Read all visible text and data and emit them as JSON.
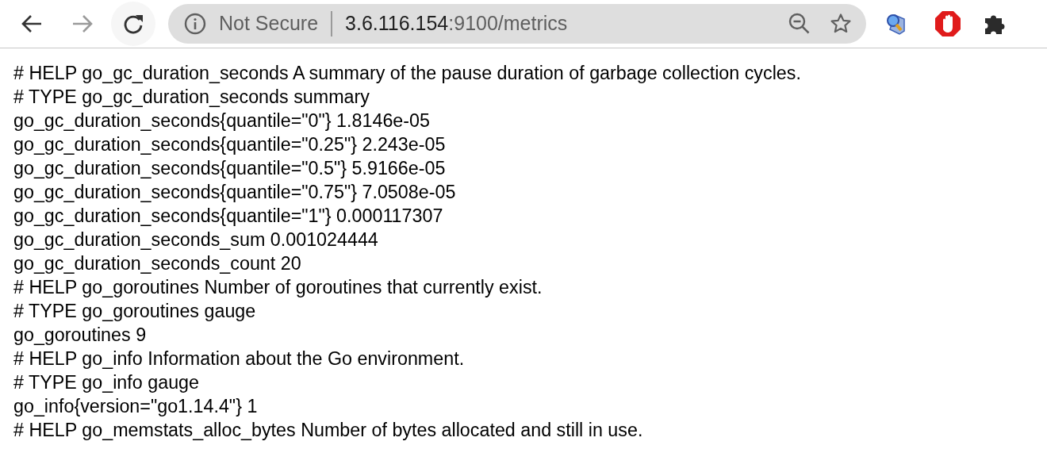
{
  "toolbar": {
    "security_label": "Not Secure",
    "url_host": "3.6.116.154",
    "url_rest": ":9100/metrics",
    "forward_disabled": true
  },
  "lines": [
    "# HELP go_gc_duration_seconds A summary of the pause duration of garbage collection cycles.",
    "# TYPE go_gc_duration_seconds summary",
    "go_gc_duration_seconds{quantile=\"0\"} 1.8146e-05",
    "go_gc_duration_seconds{quantile=\"0.25\"} 2.243e-05",
    "go_gc_duration_seconds{quantile=\"0.5\"} 5.9166e-05",
    "go_gc_duration_seconds{quantile=\"0.75\"} 7.0508e-05",
    "go_gc_duration_seconds{quantile=\"1\"} 0.000117307",
    "go_gc_duration_seconds_sum 0.001024444",
    "go_gc_duration_seconds_count 20",
    "# HELP go_goroutines Number of goroutines that currently exist.",
    "# TYPE go_goroutines gauge",
    "go_goroutines 9",
    "# HELP go_info Information about the Go environment.",
    "# TYPE go_info gauge",
    "go_info{version=\"go1.14.4\"} 1",
    "# HELP go_memstats_alloc_bytes Number of bytes allocated and still in use."
  ]
}
